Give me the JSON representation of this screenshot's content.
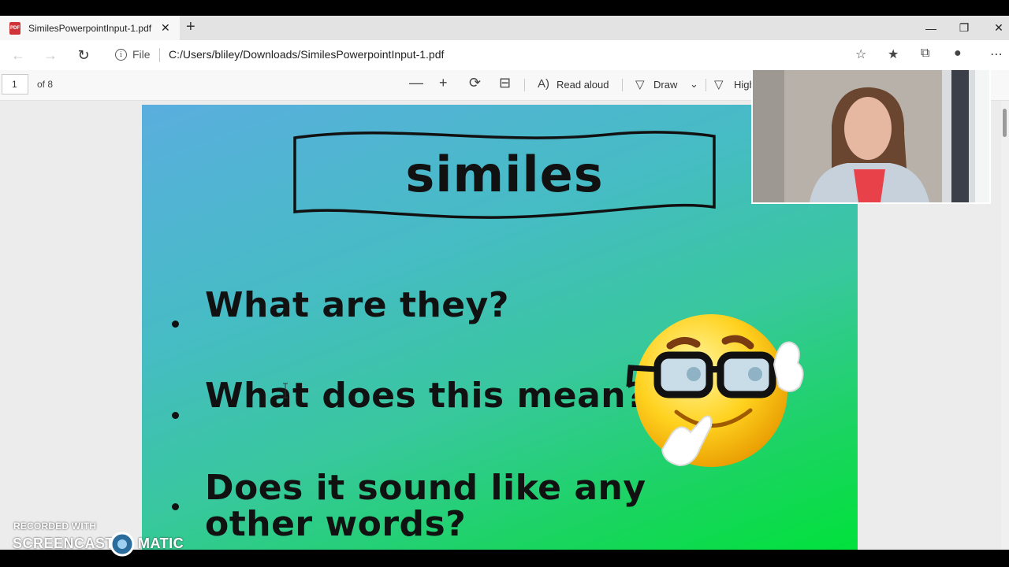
{
  "browser": {
    "tab_title": "SimilesPowerpointInput-1.pdf",
    "pdf_badge": "PDF",
    "file_label": "File",
    "url": "C:/Users/bliley/Downloads/SimilesPowerpointInput-1.pdf"
  },
  "pdf_toolbar": {
    "page_number": "1",
    "page_total": "of 8",
    "read_aloud": "Read aloud",
    "draw": "Draw",
    "highlight": "High"
  },
  "slide": {
    "title": "similes",
    "bullets": [
      "What are they?",
      "What does this mean?",
      "Does it sound like any",
      "other words?"
    ]
  },
  "watermark": {
    "recorded_with": "RECORDED WITH",
    "brand_left": "SCREENCAST",
    "brand_right": "MATIC"
  },
  "icons": {
    "back": "back-arrow-icon",
    "forward": "forward-arrow-icon",
    "refresh": "refresh-icon",
    "info": "info-icon",
    "zoom_out": "minus-icon",
    "zoom_in": "plus-icon",
    "rotate": "rotate-icon",
    "fit": "fit-page-icon",
    "read_aloud": "read-aloud-icon",
    "draw": "draw-pen-icon",
    "highlight": "highlighter-icon"
  },
  "colors": {
    "slide_gradient_top": "#5aaede",
    "slide_gradient_bottom": "#00e23a",
    "pdf_icon": "#d13438"
  }
}
